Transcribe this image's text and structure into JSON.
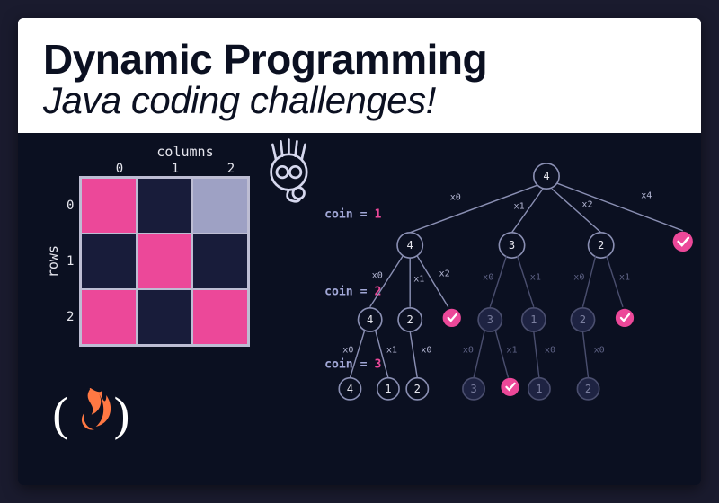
{
  "title": {
    "line1": "Dynamic Programming",
    "line2": "Java coding challenges!"
  },
  "grid": {
    "cols_label": "columns",
    "rows_label": "rows",
    "col_indices": [
      "0",
      "1",
      "2"
    ],
    "row_indices": [
      "0",
      "1",
      "2"
    ],
    "cells": [
      [
        "pink",
        "navy",
        "grey"
      ],
      [
        "navy",
        "pink",
        "navy"
      ],
      [
        "pink",
        "navy",
        "pink"
      ]
    ],
    "colors": {
      "pink": "#ec4899",
      "navy": "#181c3a",
      "grey": "#9ea1c4"
    }
  },
  "tree": {
    "coin_labels": [
      {
        "key": "coin = ",
        "val": "1"
      },
      {
        "key": "coin = ",
        "val": "2"
      },
      {
        "key": "coin = ",
        "val": "3"
      }
    ],
    "root": "4",
    "level1": {
      "nodes": [
        "4",
        "3",
        "2",
        "✓"
      ],
      "edges": [
        "x0",
        "x1",
        "x2",
        "x4"
      ]
    },
    "level2": {
      "a": {
        "nodes": [
          "4",
          "2",
          "✓"
        ],
        "edges": [
          "x0",
          "x1",
          "x2"
        ]
      },
      "b": {
        "nodes": [
          "3",
          "1"
        ],
        "edges": [
          "x0",
          "x1"
        ]
      },
      "c": {
        "nodes": [
          "2",
          "✓"
        ],
        "edges": [
          "x0",
          "x1"
        ]
      }
    },
    "level3": {
      "a": {
        "nodes": [
          "4",
          "1"
        ],
        "edges": [
          "x0",
          "x1"
        ]
      },
      "b": {
        "nodes": [
          "2"
        ],
        "edges": [
          "x0"
        ]
      },
      "c": {
        "nodes": [
          "3",
          "✓"
        ],
        "edges": [
          "x0",
          "x1"
        ]
      },
      "d": {
        "nodes": [
          "1"
        ],
        "edges": [
          "x0"
        ]
      },
      "e": {
        "nodes": [
          "2"
        ],
        "edges": [
          "x0"
        ]
      }
    }
  },
  "logo": {
    "open": "(",
    "close": ")",
    "icon": "flame-icon"
  }
}
